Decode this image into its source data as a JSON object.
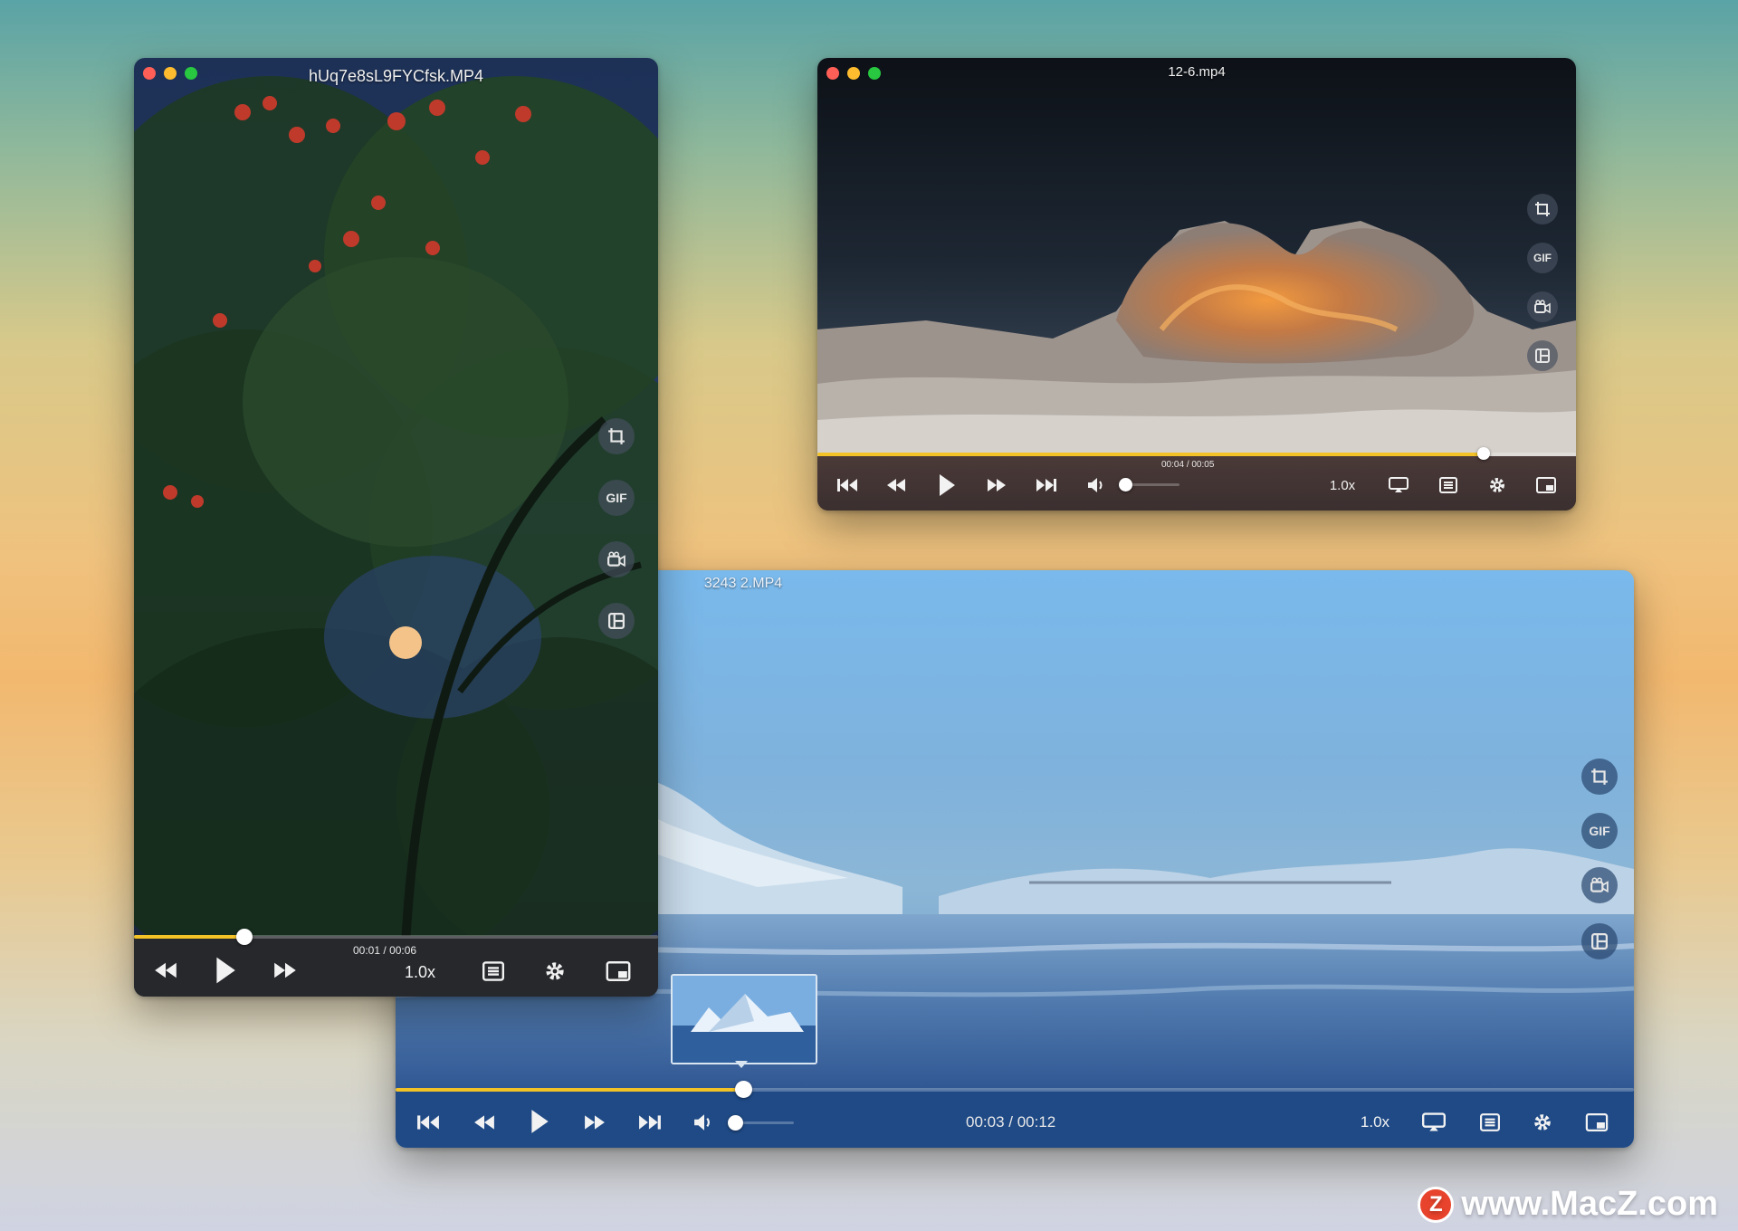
{
  "windows": {
    "tree": {
      "title": "hUq7e8sL9FYCfsk.MP4",
      "time_current": "00:01",
      "time_total": "00:06",
      "time_sep": "/",
      "speed": "1.0x",
      "progress": 0.2,
      "side_gif_label": "GIF"
    },
    "desert": {
      "title": "12-6.mp4",
      "time_current": "00:04",
      "time_total": "00:05",
      "time_sep": "/",
      "speed": "1.0x",
      "progress": 0.88,
      "volume": 0.1,
      "side_gif_label": "GIF"
    },
    "ice": {
      "title": "3243 2.MP4",
      "time_text": "00:03 / 00:12",
      "speed": "1.0x",
      "progress": 0.28,
      "volume": 0.1,
      "side_gif_label": "GIF"
    }
  },
  "watermark": {
    "logo_letter": "Z",
    "text": "www.MacZ.com"
  },
  "colors": {
    "progress_fill": "#f2c227",
    "close": "#ff5f57",
    "minimize": "#febc2e",
    "zoom": "#28c840"
  }
}
